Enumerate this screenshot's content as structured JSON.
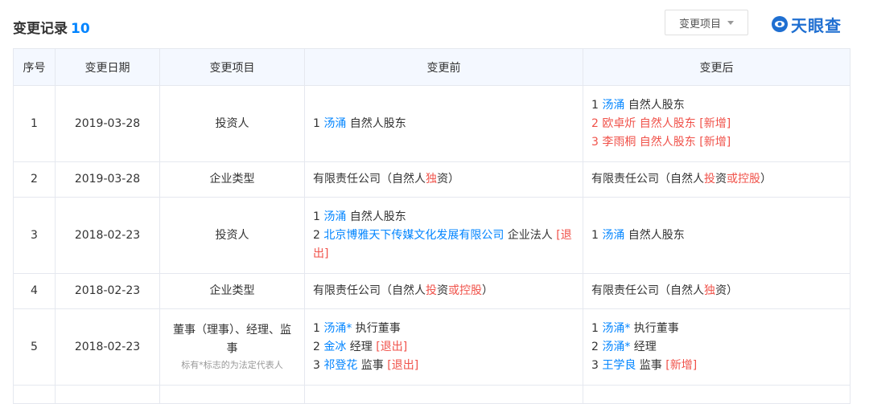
{
  "header": {
    "title": "变更记录",
    "count": "10",
    "filter_label": "变更项目",
    "logo_text": "天眼查"
  },
  "table": {
    "columns": [
      "序号",
      "变更日期",
      "变更项目",
      "变更前",
      "变更后"
    ],
    "rows": [
      {
        "num": "1",
        "date": "2019-03-28",
        "item": "投资人",
        "item_note": "",
        "before": [
          [
            {
              "t": "1 "
            },
            {
              "t": "汤涌",
              "c": "blue"
            },
            {
              "t": " 自然人股东"
            }
          ]
        ],
        "after": [
          [
            {
              "t": "1 "
            },
            {
              "t": "汤涌",
              "c": "blue"
            },
            {
              "t": " 自然人股东"
            }
          ],
          [
            {
              "t": "2 欧卓炘 自然人股东 [新增]",
              "c": "red"
            }
          ],
          [
            {
              "t": "3 李雨桐 自然人股东 [新增]",
              "c": "red"
            }
          ]
        ]
      },
      {
        "num": "2",
        "date": "2019-03-28",
        "item": "企业类型",
        "item_note": "",
        "before": [
          [
            {
              "t": "有限责任公司（自然人"
            },
            {
              "t": "独",
              "c": "red"
            },
            {
              "t": "资）"
            }
          ]
        ],
        "after": [
          [
            {
              "t": "有限责任公司（自然人"
            },
            {
              "t": "投",
              "c": "red"
            },
            {
              "t": "资"
            },
            {
              "t": "或控股",
              "c": "red"
            },
            {
              "t": "）"
            }
          ]
        ]
      },
      {
        "num": "3",
        "date": "2018-02-23",
        "item": "投资人",
        "item_note": "",
        "before": [
          [
            {
              "t": "1 "
            },
            {
              "t": "汤涌",
              "c": "blue"
            },
            {
              "t": " 自然人股东"
            }
          ],
          [
            {
              "t": "2 "
            },
            {
              "t": "北京博雅天下传媒文化发展有限公司",
              "c": "blue"
            },
            {
              "t": " 企业法人 "
            },
            {
              "t": "[退出]",
              "c": "red"
            }
          ]
        ],
        "after": [
          [
            {
              "t": "1 "
            },
            {
              "t": "汤涌",
              "c": "blue"
            },
            {
              "t": " 自然人股东"
            }
          ]
        ]
      },
      {
        "num": "4",
        "date": "2018-02-23",
        "item": "企业类型",
        "item_note": "",
        "before": [
          [
            {
              "t": "有限责任公司（自然人"
            },
            {
              "t": "投",
              "c": "red"
            },
            {
              "t": "资"
            },
            {
              "t": "或控股",
              "c": "red"
            },
            {
              "t": "）"
            }
          ]
        ],
        "after": [
          [
            {
              "t": "有限责任公司（自然人"
            },
            {
              "t": "独",
              "c": "red"
            },
            {
              "t": "资）"
            }
          ]
        ]
      },
      {
        "num": "5",
        "date": "2018-02-23",
        "item": "董事（理事）、经理、监事",
        "item_note": "标有*标志的为法定代表人",
        "before": [
          [
            {
              "t": "1 "
            },
            {
              "t": "汤涌*",
              "c": "blue"
            },
            {
              "t": " 执行董事"
            }
          ],
          [
            {
              "t": "2 "
            },
            {
              "t": "金冰",
              "c": "blue"
            },
            {
              "t": " 经理 "
            },
            {
              "t": "[退出]",
              "c": "red"
            }
          ],
          [
            {
              "t": "3 "
            },
            {
              "t": "祁登花",
              "c": "blue"
            },
            {
              "t": " 监事 "
            },
            {
              "t": "[退出]",
              "c": "red"
            }
          ]
        ],
        "after": [
          [
            {
              "t": "1 "
            },
            {
              "t": "汤涌*",
              "c": "blue"
            },
            {
              "t": " 执行董事"
            }
          ],
          [
            {
              "t": "2 "
            },
            {
              "t": "汤涌*",
              "c": "blue"
            },
            {
              "t": " 经理"
            }
          ],
          [
            {
              "t": "3 "
            },
            {
              "t": "王学良",
              "c": "blue"
            },
            {
              "t": " 监事 "
            },
            {
              "t": "[新增]",
              "c": "red"
            }
          ]
        ]
      }
    ]
  },
  "colors": {
    "link": "#0084ff",
    "highlight": "#f0524a",
    "header_bg": "#f4f8ff",
    "border": "#e5e8ef"
  }
}
